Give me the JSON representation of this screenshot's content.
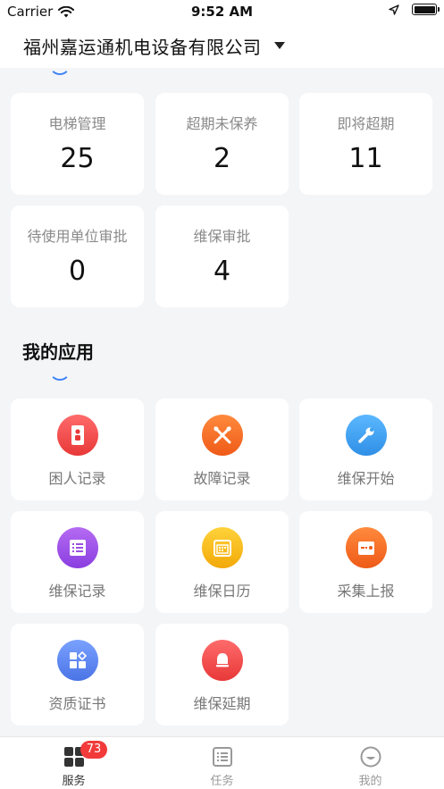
{
  "status_bar": {
    "carrier": "Carrier",
    "time": "9:52 AM"
  },
  "header": {
    "company": "福州嘉运通机电设备有限公司"
  },
  "stats": [
    {
      "label": "电梯管理",
      "value": "25"
    },
    {
      "label": "超期未保养",
      "value": "2"
    },
    {
      "label": "即将超期",
      "value": "11"
    },
    {
      "label": "待使用单位审批",
      "value": "0"
    },
    {
      "label": "维保审批",
      "value": "4"
    }
  ],
  "apps_section": {
    "title": "我的应用"
  },
  "apps": [
    {
      "label": "困人记录",
      "icon": "person-trapped-icon",
      "color": "#f04a4a"
    },
    {
      "label": "故障记录",
      "icon": "tools-icon",
      "color": "#f46a23"
    },
    {
      "label": "维保开始",
      "icon": "wrench-icon",
      "color": "#3aa0ef"
    },
    {
      "label": "维保记录",
      "icon": "list-icon",
      "color": "#9b4fe3"
    },
    {
      "label": "维保日历",
      "icon": "calendar-icon",
      "color": "#f6b512"
    },
    {
      "label": "采集上报",
      "icon": "upload-icon",
      "color": "#f46a23"
    },
    {
      "label": "资质证书",
      "icon": "certificate-icon",
      "color": "#5a86ee"
    },
    {
      "label": "维保延期",
      "icon": "bell-icon",
      "color": "#f04a4a"
    }
  ],
  "tab_bar": {
    "tabs": [
      {
        "label": "服务",
        "badge": "73",
        "icon": "services-grid-icon"
      },
      {
        "label": "任务",
        "icon": "task-list-icon"
      },
      {
        "label": "我的",
        "icon": "profile-icon"
      }
    ]
  }
}
